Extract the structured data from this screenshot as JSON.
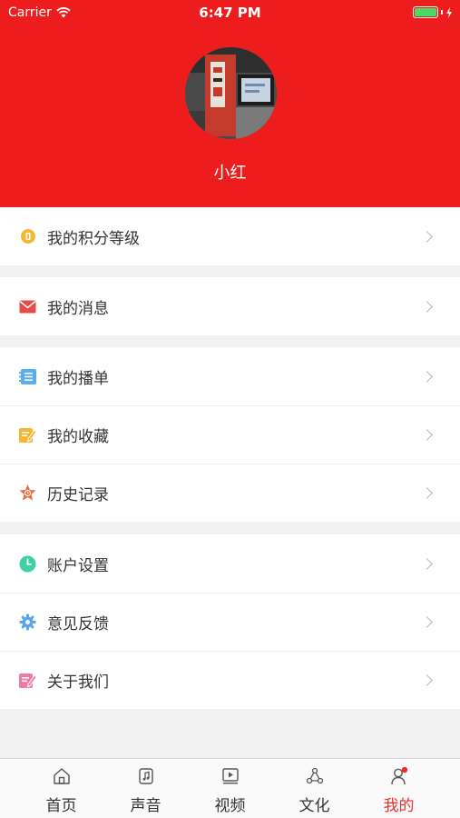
{
  "status_bar": {
    "carrier": "Carrier",
    "time": "6:47 PM"
  },
  "profile": {
    "username": "小红"
  },
  "menu_groups": [
    [
      {
        "label": "我的积分等级",
        "icon": "coin-icon"
      }
    ],
    [
      {
        "label": "我的消息",
        "icon": "mail-icon"
      }
    ],
    [
      {
        "label": "我的播单",
        "icon": "playlist-icon"
      },
      {
        "label": "我的收藏",
        "icon": "favorites-icon"
      },
      {
        "label": "历史记录",
        "icon": "history-star-icon"
      }
    ],
    [
      {
        "label": "账户设置",
        "icon": "clock-icon"
      },
      {
        "label": "意见反馈",
        "icon": "gear-icon"
      },
      {
        "label": "关于我们",
        "icon": "edit-note-icon"
      }
    ]
  ],
  "tabs": [
    {
      "label": "首页",
      "icon": "home-icon"
    },
    {
      "label": "声音",
      "icon": "audio-icon"
    },
    {
      "label": "视频",
      "icon": "video-icon"
    },
    {
      "label": "文化",
      "icon": "culture-icon"
    },
    {
      "label": "我的",
      "icon": "profile-icon",
      "active": true
    }
  ],
  "colors": {
    "header": "#ee1d1d",
    "active_tab": "#e8312e"
  }
}
